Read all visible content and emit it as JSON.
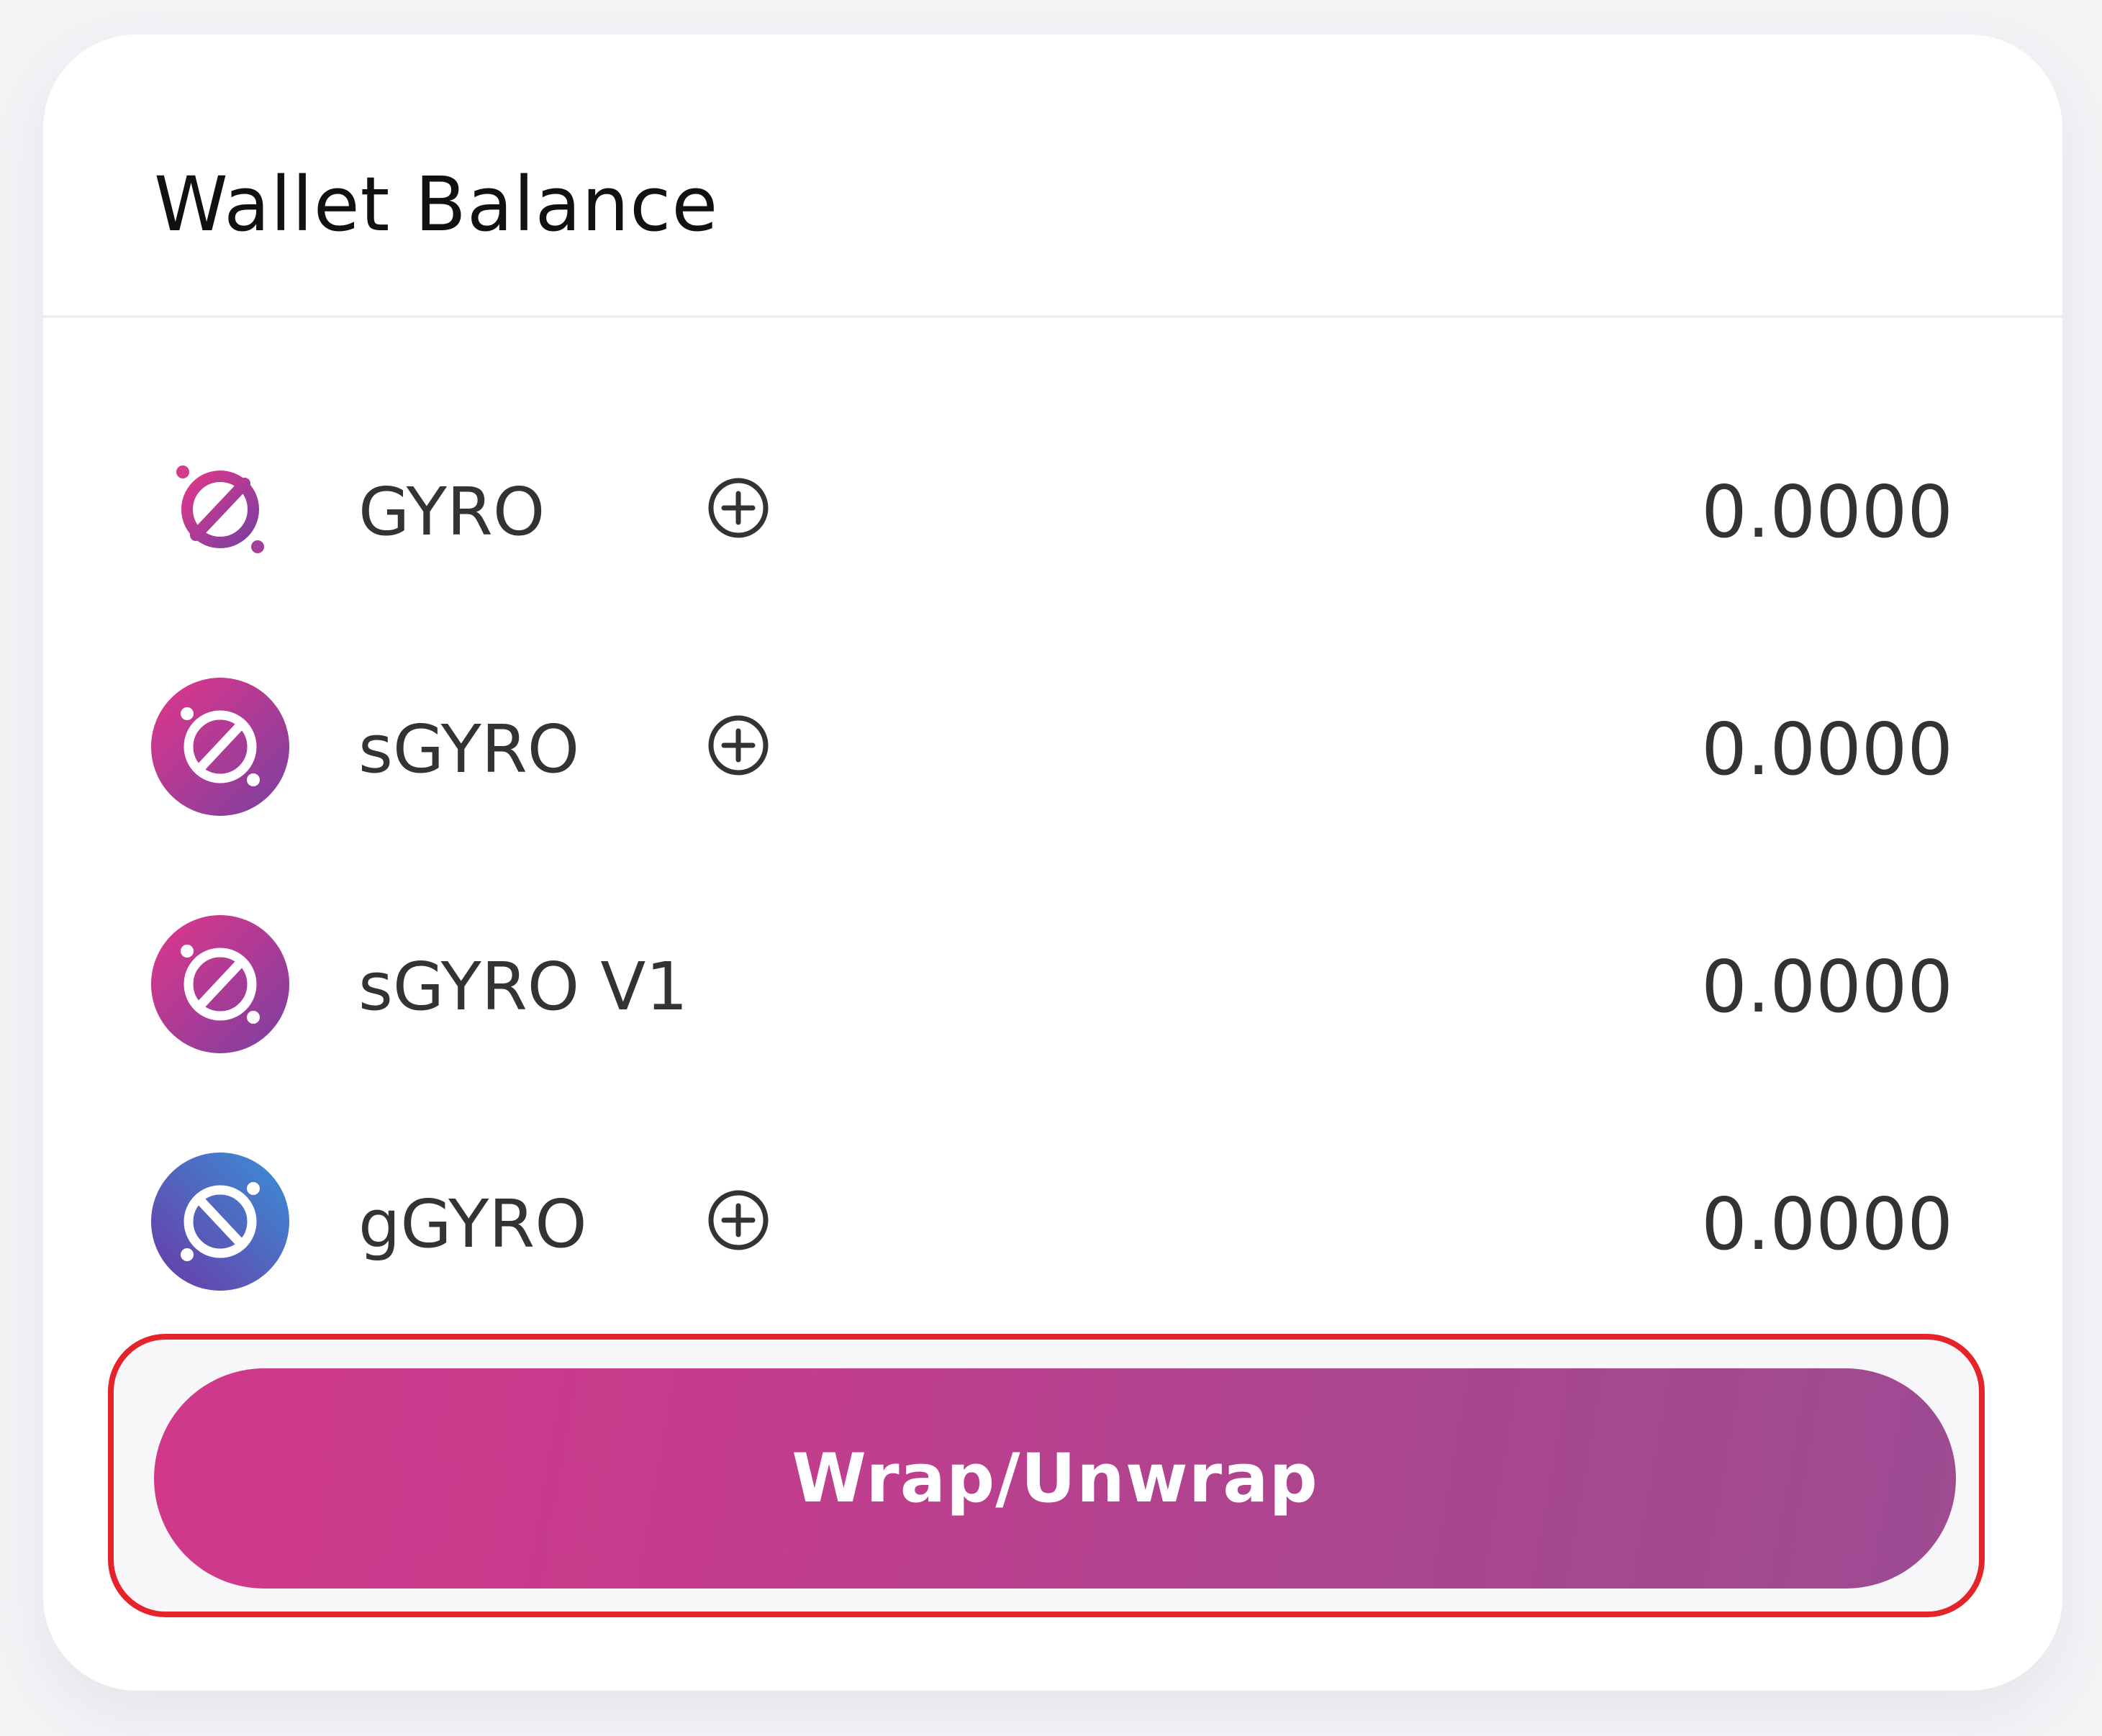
{
  "wallet": {
    "title": "Wallet Balance",
    "tokens": [
      {
        "name": "GYRO",
        "value": "0.0000",
        "icon": "gyro-logo-icon",
        "add": true
      },
      {
        "name": "sGYRO",
        "value": "0.0000",
        "icon": "sgyro-logo-icon",
        "add": true
      },
      {
        "name": "sGYRO V1",
        "value": "0.0000",
        "icon": "sgyro-v1-logo-icon",
        "add": false
      },
      {
        "name": "gGYRO",
        "value": "0.0000",
        "icon": "ggyro-logo-icon",
        "add": true
      }
    ],
    "action_label": "Wrap/Unwrap"
  },
  "colors": {
    "brand_pink": "#d0398a",
    "brand_purple": "#9d4b92",
    "ggyro_blue": "#3f7fcf",
    "highlight_red": "#e5232b"
  }
}
